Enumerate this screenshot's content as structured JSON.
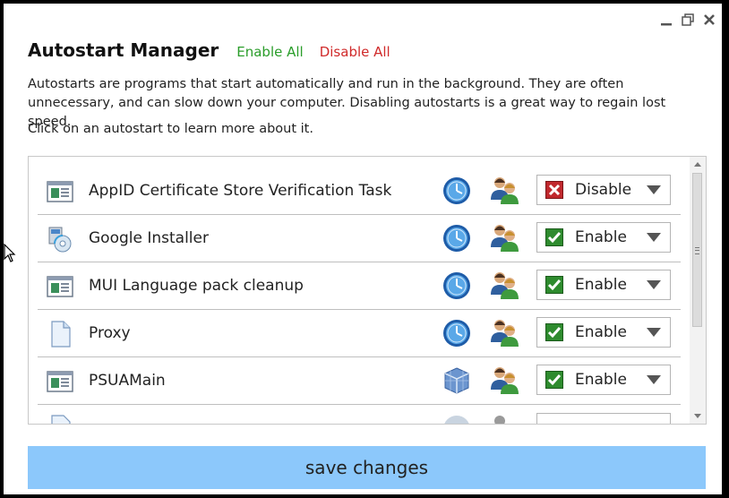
{
  "window": {
    "controls": [
      "minimize-icon",
      "restore-icon",
      "close-icon"
    ]
  },
  "header": {
    "title": "Autostart Manager",
    "enable_all": "Enable All",
    "disable_all": "Disable All"
  },
  "description": "Autostarts are programs that start automatically and run in the background. They are often unnecessary, and can slow down your computer. Disabling autostarts is a great way to regain lost speed.",
  "hint": "Click on an autostart to learn more about it.",
  "items": [
    {
      "name": "AppID Certificate Store Verification Task",
      "icon": "window-app-icon",
      "type_icon": "clock-icon",
      "users_icon": "users-icon",
      "status": "Disable"
    },
    {
      "name": "Google Installer",
      "icon": "installer-icon",
      "type_icon": "clock-icon",
      "users_icon": "users-icon",
      "status": "Enable"
    },
    {
      "name": "MUI Language pack cleanup",
      "icon": "window-app-icon",
      "type_icon": "clock-icon",
      "users_icon": "users-icon",
      "status": "Enable"
    },
    {
      "name": "Proxy",
      "icon": "document-icon",
      "type_icon": "clock-icon",
      "users_icon": "users-icon",
      "status": "Enable"
    },
    {
      "name": "PSUAMain",
      "icon": "window-app-icon",
      "type_icon": "cubes-icon",
      "users_icon": "users-icon",
      "status": "Enable"
    }
  ],
  "save_button": "save changes",
  "colors": {
    "enable_link": "#2a9d2a",
    "disable_link": "#d02a2a",
    "save_button_bg": "#8cc8fb",
    "check_green": "#2e8b2e",
    "cross_red": "#c0282d"
  }
}
